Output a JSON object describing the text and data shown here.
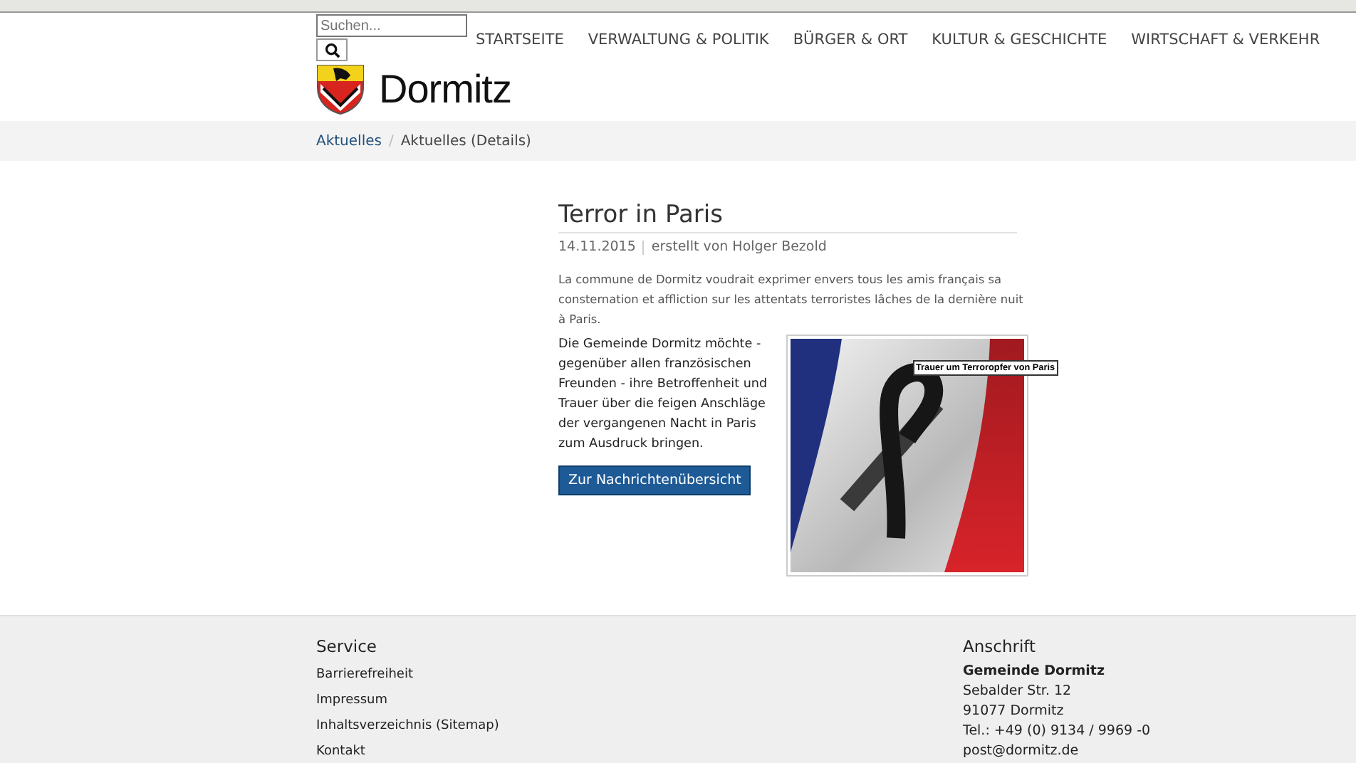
{
  "header": {
    "search": {
      "placeholder": "Suchen..."
    },
    "nav": [
      {
        "label": "STARTSEITE"
      },
      {
        "label": "VERWALTUNG & POLITIK"
      },
      {
        "label": "BÜRGER & ORT"
      },
      {
        "label": "KULTUR & GESCHICHTE"
      },
      {
        "label": "WIRTSCHAFT & VERKEHR"
      }
    ],
    "site_name": "Dormitz"
  },
  "breadcrumb_separator": "/",
  "breadcrumb": [
    {
      "label": "Aktuelles",
      "kind": "link"
    },
    {
      "label": "Aktuelles (Details)",
      "kind": "current"
    }
  ],
  "article": {
    "title": "Terror in Paris",
    "date": "14.11.2015",
    "author": "erstellt von Holger Bezold",
    "intro": "La commune de Dormitz voudrait exprimer envers tous les amis français sa consternation et affliction sur les attentats terroristes lâches de la dernière nuit à Paris.",
    "body": "Die Gemeinde Dormitz möchte - gegenüber allen französischen Freunden - ihre Betroffenheit und Trauer über die feigen Anschläge der vergangenen Nacht in Paris zum Ausdruck bringen.",
    "button": "Zur Nachrichtenübersicht",
    "image_tooltip": "Trauer um Terroropfer von Paris"
  },
  "footer": {
    "service": {
      "title": "Service",
      "links": [
        "Barrierefreiheit",
        "Impressum",
        "Inhaltsverzeichnis (Sitemap)",
        "Kontakt"
      ]
    },
    "address": {
      "title": "Anschrift",
      "name": "Gemeinde Dormitz",
      "lines": [
        "Sebalder Str. 12",
        "91077 Dormitz",
        "Tel.: +49 (0) 9134 / 9969 -0",
        "post@dormitz.de"
      ]
    }
  }
}
